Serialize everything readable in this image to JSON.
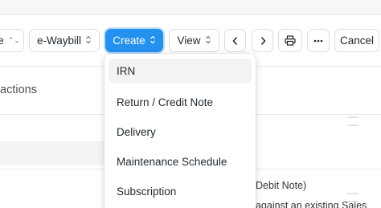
{
  "toolbar": {
    "partial_button_label": "e",
    "ewaybill_label": "e-Waybill",
    "create_label": "Create",
    "view_label": "View",
    "cancel_label": "Cancel"
  },
  "background": {
    "section_heading": "actions",
    "text_debit_note": "Debit Note)",
    "text_against": "against an existing Sales"
  },
  "create_menu": {
    "items": [
      {
        "label": "IRN"
      },
      {
        "label": "Return / Credit Note"
      },
      {
        "label": "Delivery"
      },
      {
        "label": "Maintenance Schedule"
      },
      {
        "label": "Subscription"
      }
    ]
  },
  "colors": {
    "primary": "#2490ef",
    "border": "#d9dde1",
    "menu_hover": "#f3f3f3"
  },
  "icons": {
    "dropdown_indicator": "up-down-chevron-icon",
    "prev": "chevron-left-icon",
    "next": "chevron-right-icon",
    "print": "printer-icon",
    "more": "ellipsis-icon"
  }
}
